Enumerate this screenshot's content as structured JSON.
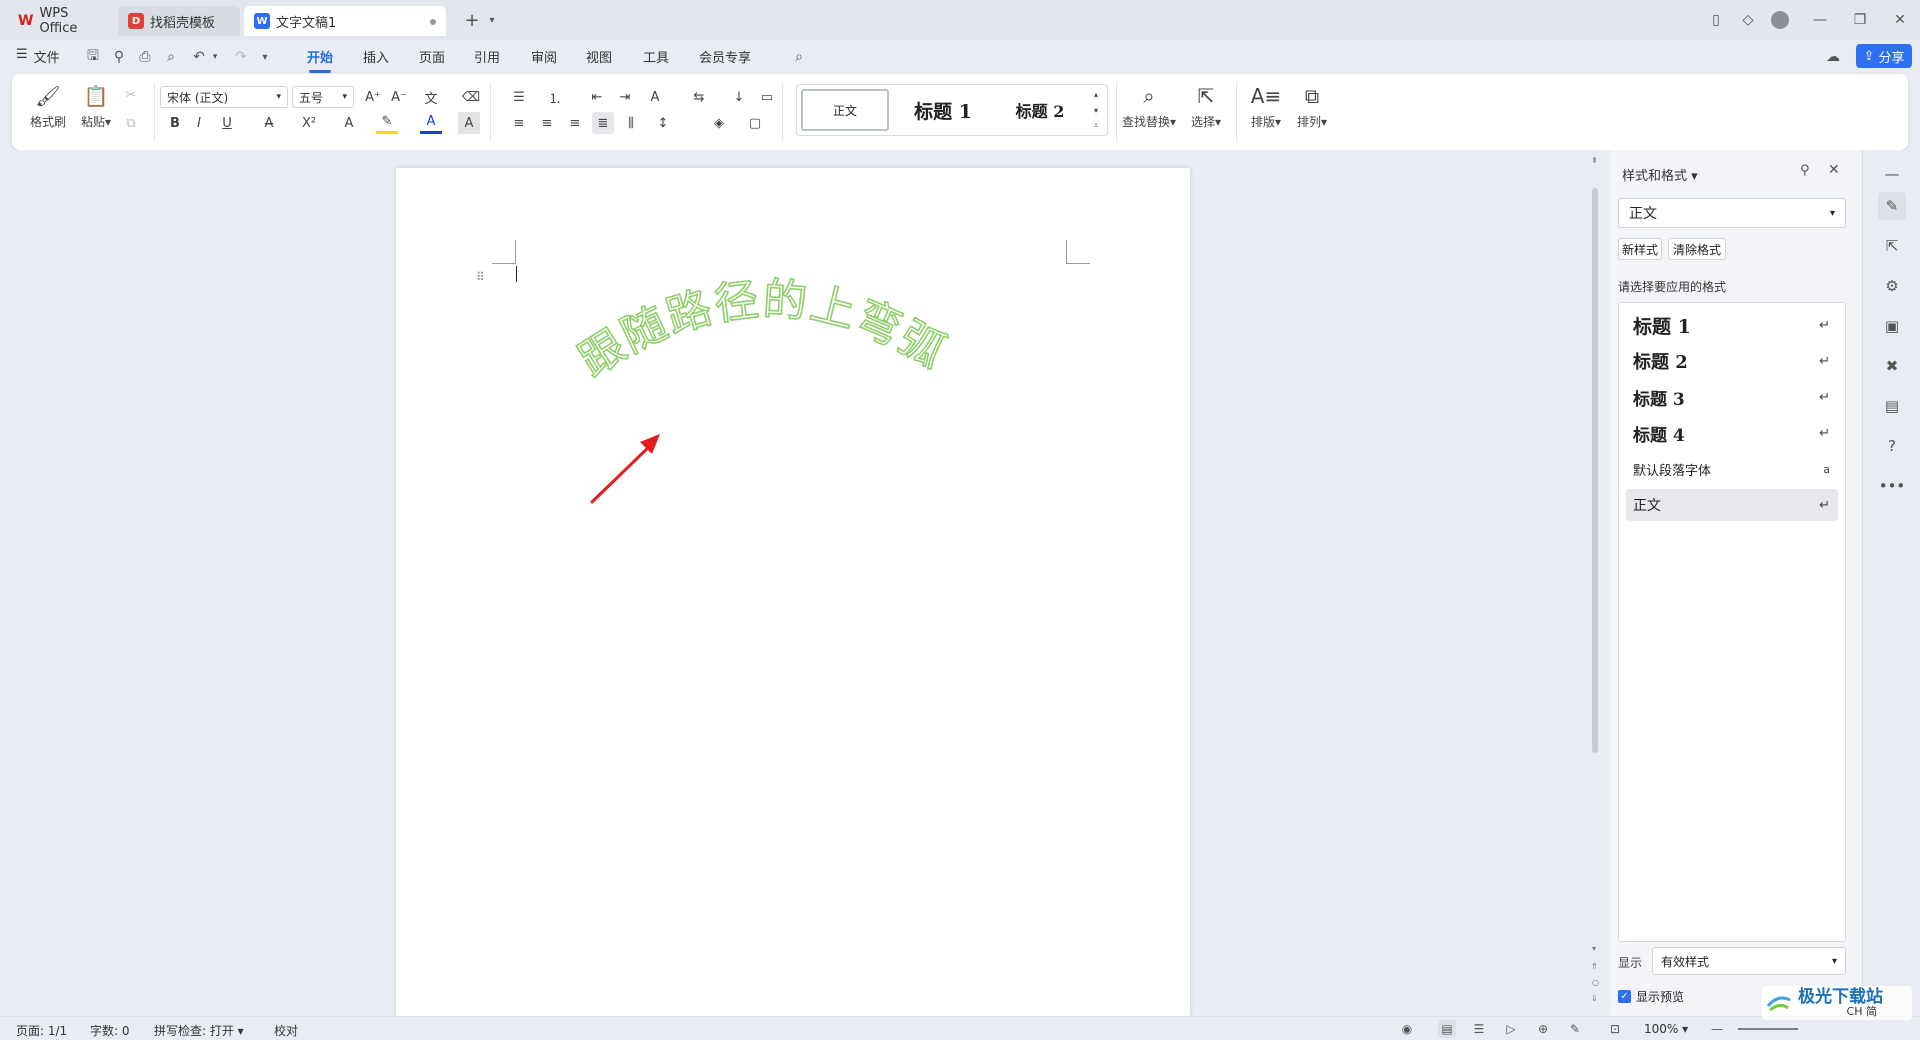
{
  "tabs": [
    {
      "label": "WPS Office"
    },
    {
      "label": "找稻壳模板"
    },
    {
      "label": "文字文稿1"
    }
  ],
  "menu": {
    "file": "文件",
    "items": [
      "开始",
      "插入",
      "页面",
      "引用",
      "审阅",
      "视图",
      "工具",
      "会员专享"
    ],
    "active": "开始",
    "share": "分享"
  },
  "ribbon": {
    "format_painter": "格式刷",
    "paste": "粘贴",
    "font_name": "宋体 (正文)",
    "font_size": "五号",
    "styles": [
      "正文",
      "标题 1",
      "标题 2"
    ],
    "find_replace": "查找替换",
    "select": "选择",
    "layout": "排版",
    "arrange": "排列"
  },
  "document": {
    "arc_text": "跟随路径的上弯弧",
    "arc_color": "#8fcf6a",
    "arrow_color": "#e31c1c"
  },
  "pane": {
    "title": "样式和格式",
    "current_style": "正文",
    "new_style": "新样式",
    "clear_format": "清除格式",
    "hint": "请选择要应用的格式",
    "styles": [
      {
        "name": "标题  1",
        "mark": "↵"
      },
      {
        "name": "标题  2",
        "mark": "↵"
      },
      {
        "name": "标题  3",
        "mark": "↵"
      },
      {
        "name": "标题 4",
        "mark": "↵"
      },
      {
        "name": "默认段落字体",
        "mark": "a"
      },
      {
        "name": "正文",
        "mark": "↵"
      }
    ],
    "show_label": "显示",
    "show_value": "有效样式",
    "preview_label": "显示预览"
  },
  "status": {
    "page": "页面: 1/1",
    "words": "字数: 0",
    "spell": "拼写检查: 打开",
    "proof": "校对",
    "zoom": "100%"
  },
  "watermark": {
    "text": "极光下载站",
    "sub": "CH 简"
  }
}
